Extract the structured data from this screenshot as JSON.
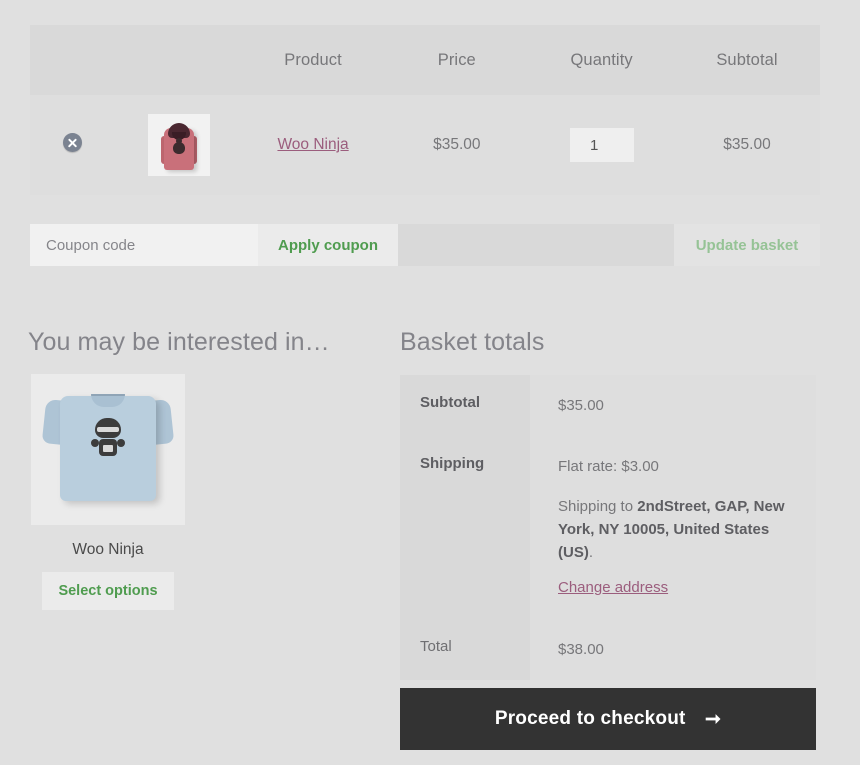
{
  "cart": {
    "headers": {
      "remove": "",
      "thumbnail": "",
      "product": "Product",
      "price": "Price",
      "quantity": "Quantity",
      "subtotal": "Subtotal"
    },
    "items": [
      {
        "remove_icon": "remove-circle-x-icon",
        "thumbnail_icon": "hoodie-thumbnail",
        "name": "Woo Ninja",
        "price": "$35.00",
        "quantity": "1",
        "subtotal": "$35.00"
      }
    ]
  },
  "coupon": {
    "placeholder": "Coupon code",
    "value": "",
    "apply_label": "Apply coupon",
    "update_label": "Update basket"
  },
  "upsell": {
    "heading": "You may be interested in…",
    "products": [
      {
        "thumbnail_icon": "tshirt-ninja-thumbnail",
        "name": "Woo Ninja",
        "button_label": "Select options"
      }
    ]
  },
  "totals": {
    "heading": "Basket totals",
    "rows": [
      {
        "label": "Subtotal",
        "value": "$35.00"
      },
      {
        "label": "Shipping",
        "value": ""
      },
      {
        "label": "Total",
        "value": "$38.00"
      }
    ],
    "shipping": {
      "method": "Flat rate: $3.00",
      "ship_to_prefix": "Shipping to ",
      "address": "2ndStreet, GAP, New York, NY 10005, United States (US)",
      "address_suffix": ".",
      "change_address_label": "Change address"
    },
    "checkout": {
      "label": "Proceed to checkout",
      "arrow": "➞"
    }
  },
  "colors": {
    "page_background": "#e0e0e0",
    "table_header_background": "#d9d9d9",
    "table_row_background": "#dedede",
    "link": "#9b5d7d",
    "green_action": "#4f9c4f",
    "green_disabled": "#96c396",
    "checkout_background": "#333333",
    "text_muted": "#77777a"
  }
}
